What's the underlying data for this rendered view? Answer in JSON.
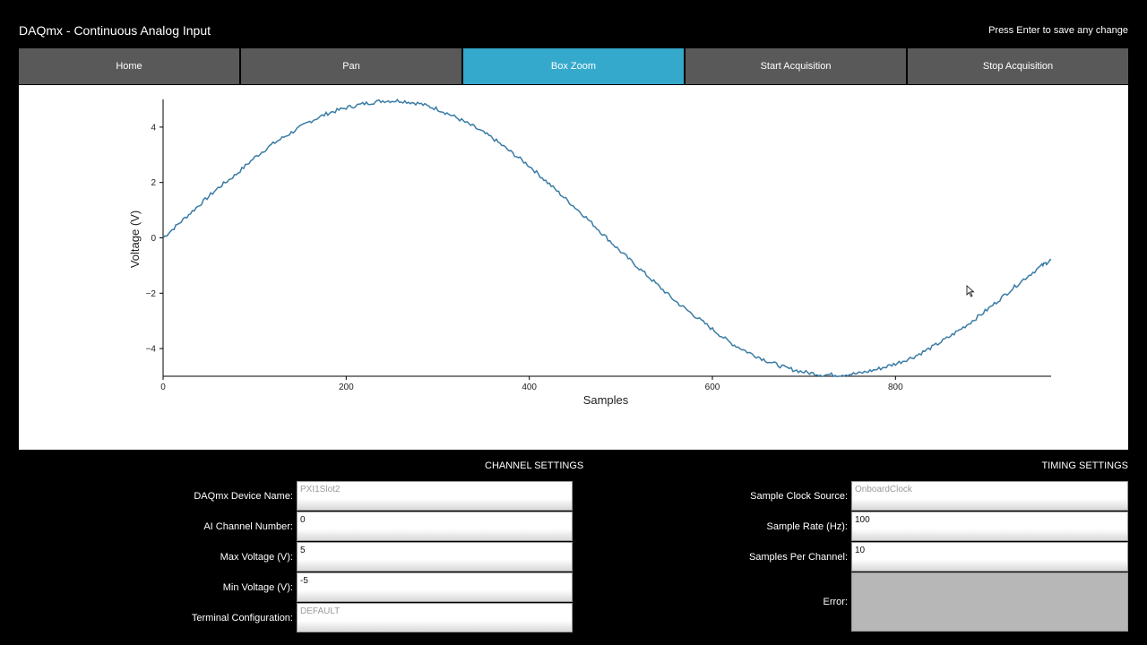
{
  "app": {
    "title": "DAQmx - Continuous Analog Input",
    "hint": "Press Enter to save any change"
  },
  "toolbar": [
    {
      "label": "Home",
      "active": false
    },
    {
      "label": "Pan",
      "active": false
    },
    {
      "label": "Box Zoom",
      "active": true
    },
    {
      "label": "Start Acquisition",
      "active": false
    },
    {
      "label": "Stop Acquisition",
      "active": false
    }
  ],
  "channel_settings": {
    "title": "CHANNEL SETTINGS",
    "fields": [
      {
        "label": "DAQmx Device Name:",
        "value": "PXI1Slot2",
        "placeholder": true
      },
      {
        "label": "AI Channel Number:",
        "value": "0",
        "placeholder": false
      },
      {
        "label": "Max Voltage (V):",
        "value": "5",
        "placeholder": false
      },
      {
        "label": "Min Voltage (V):",
        "value": "-5",
        "placeholder": false
      },
      {
        "label": "Terminal Configuration:",
        "value": "DEFAULT",
        "placeholder": true
      }
    ]
  },
  "timing_settings": {
    "title": "TIMING SETTINGS",
    "fields": [
      {
        "label": "Sample Clock Source:",
        "value": "OnboardClock",
        "placeholder": true
      },
      {
        "label": "Sample Rate (Hz):",
        "value": "100",
        "placeholder": false
      },
      {
        "label": "Samples Per Channel:",
        "value": "10",
        "placeholder": false
      }
    ],
    "error_label": "Error:",
    "error_value": ""
  },
  "chart_data": {
    "type": "line",
    "xlabel": "Samples",
    "ylabel": "Voltage (V)",
    "xlim": [
      0,
      970
    ],
    "ylim": [
      -5,
      5
    ],
    "xticks": [
      0,
      200,
      400,
      600,
      800
    ],
    "yticks": [
      4,
      2,
      0,
      -2,
      -4
    ],
    "ytick_labels": [
      "4",
      "2",
      "0",
      "−2",
      "−4"
    ],
    "line_color": "#3a7ca5",
    "series": [
      {
        "x": [
          0,
          20,
          40,
          60,
          80,
          100,
          120,
          140,
          160,
          180,
          200,
          220,
          240,
          260,
          280,
          300,
          320,
          340,
          360,
          380,
          400,
          420,
          440,
          460,
          480,
          500,
          520,
          540,
          560,
          580,
          600,
          620,
          640,
          660,
          680,
          700,
          720,
          740,
          760,
          780,
          800,
          820,
          840,
          860,
          880,
          900,
          920,
          940,
          960,
          970
        ],
        "y": [
          0.0,
          0.6,
          1.2,
          1.8,
          2.3,
          2.9,
          3.4,
          3.8,
          4.2,
          4.5,
          4.7,
          4.85,
          4.95,
          4.95,
          4.85,
          4.65,
          4.35,
          4.0,
          3.6,
          3.1,
          2.6,
          2.0,
          1.4,
          0.8,
          0.15,
          -0.5,
          -1.1,
          -1.7,
          -2.3,
          -2.8,
          -3.3,
          -3.8,
          -4.15,
          -4.45,
          -4.7,
          -4.85,
          -4.95,
          -4.95,
          -4.9,
          -4.75,
          -4.55,
          -4.3,
          -3.95,
          -3.55,
          -3.1,
          -2.6,
          -2.05,
          -1.5,
          -1.0,
          -0.8
        ]
      }
    ]
  }
}
